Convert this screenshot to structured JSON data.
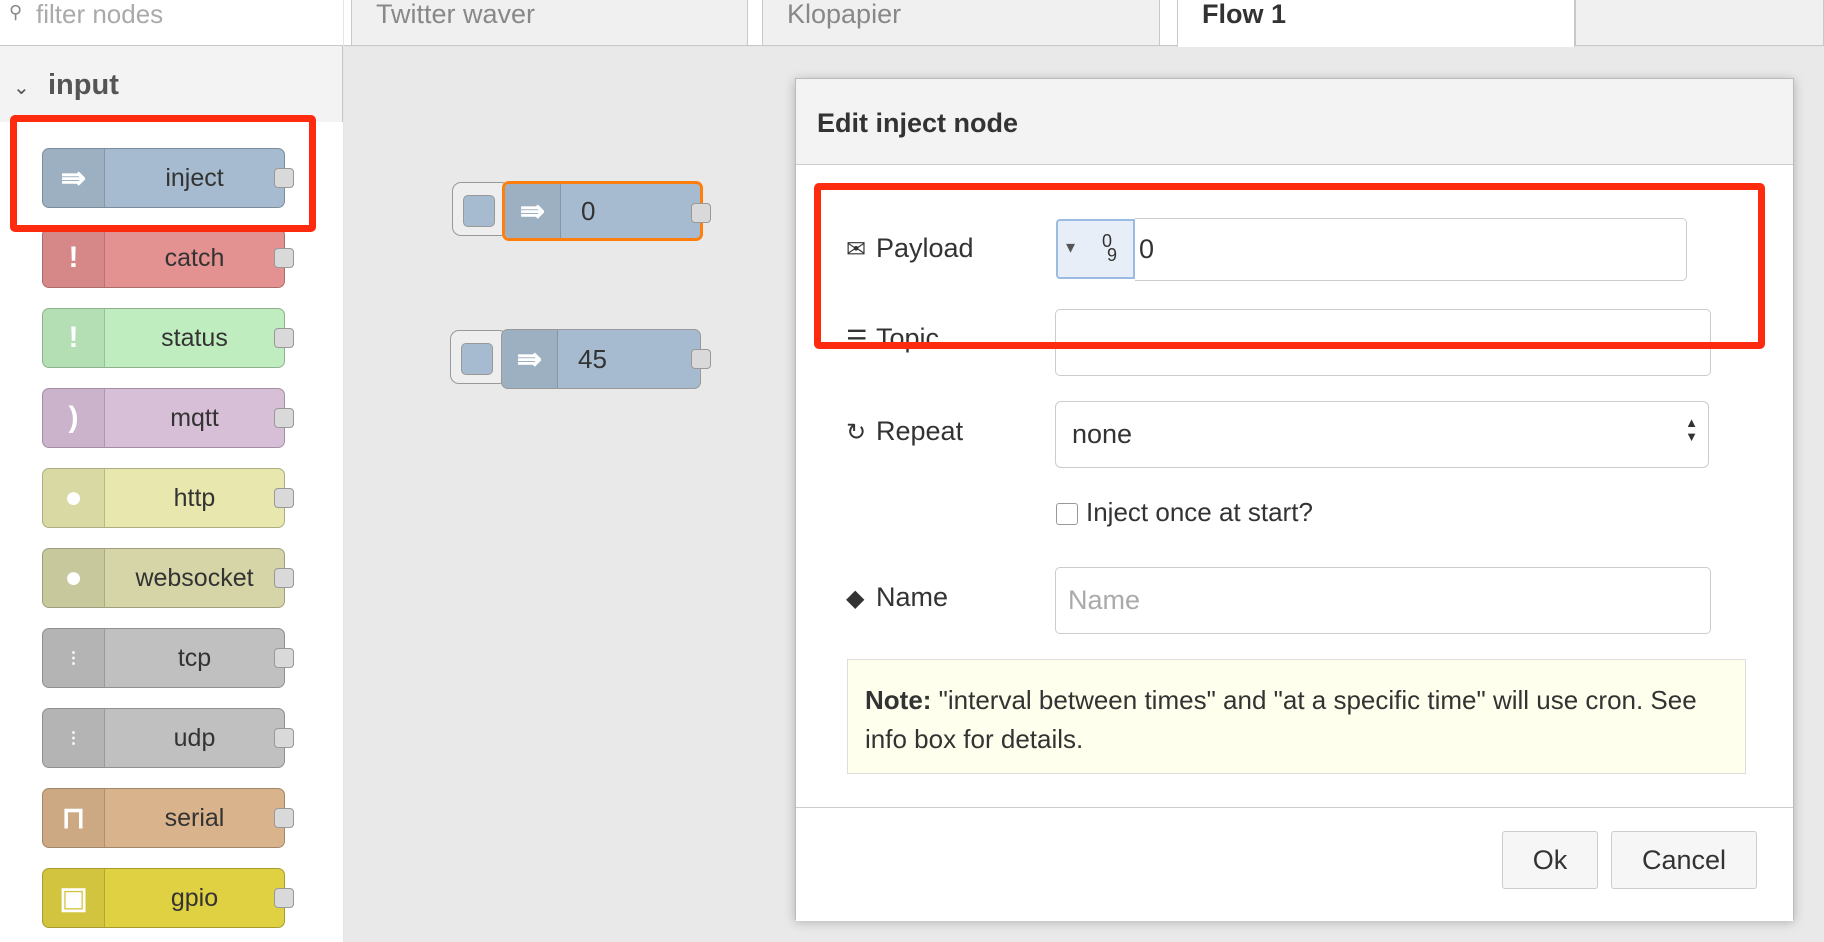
{
  "palette": {
    "filter_placeholder": "filter nodes",
    "category": "input",
    "nodes": [
      {
        "label": "inject",
        "color": "#a6bbcf",
        "icon": "arrow-in-icon"
      },
      {
        "label": "catch",
        "color": "#e49191",
        "icon": "alert-icon"
      },
      {
        "label": "status",
        "color": "#c0edc0",
        "icon": "alert-icon"
      },
      {
        "label": "mqtt",
        "color": "#d8bfd8",
        "icon": "bridge-icon"
      },
      {
        "label": "http",
        "color": "#e7e7ae",
        "icon": "globe-icon"
      },
      {
        "label": "websocket",
        "color": "#d5d5a7",
        "icon": "globe-icon"
      },
      {
        "label": "tcp",
        "color": "#c0c0c0",
        "icon": "bridge-dash-icon"
      },
      {
        "label": "udp",
        "color": "#c0c0c0",
        "icon": "bridge-dash-icon"
      },
      {
        "label": "serial",
        "color": "#d9b38c",
        "icon": "serial-icon"
      },
      {
        "label": "gpio",
        "color": "#e0d142",
        "icon": "robot-icon"
      }
    ]
  },
  "tabs": [
    "Twitter waver",
    "Klopapier",
    "Flow 1"
  ],
  "workspace": {
    "nodes": [
      {
        "label": "0",
        "selected": true
      },
      {
        "label": "45",
        "selected": false
      }
    ]
  },
  "dialog": {
    "title": "Edit inject node",
    "payload_label": "Payload",
    "payload_value": "0",
    "payload_type_glyph": "0",
    "payload_type_glyph_sub": "9",
    "topic_label": "Topic",
    "topic_value": "",
    "repeat_label": "Repeat",
    "repeat_value": "none",
    "inject_once_label": "Inject once at start?",
    "name_label": "Name",
    "name_placeholder": "Name",
    "note_bold": "Note:",
    "note_text": " \"interval between times\" and \"at a specific time\" will use cron. See info box for details.",
    "ok_label": "Ok",
    "cancel_label": "Cancel"
  },
  "highlight_color": "#ff2b0f",
  "selected_border_color": "#ff7f0e"
}
